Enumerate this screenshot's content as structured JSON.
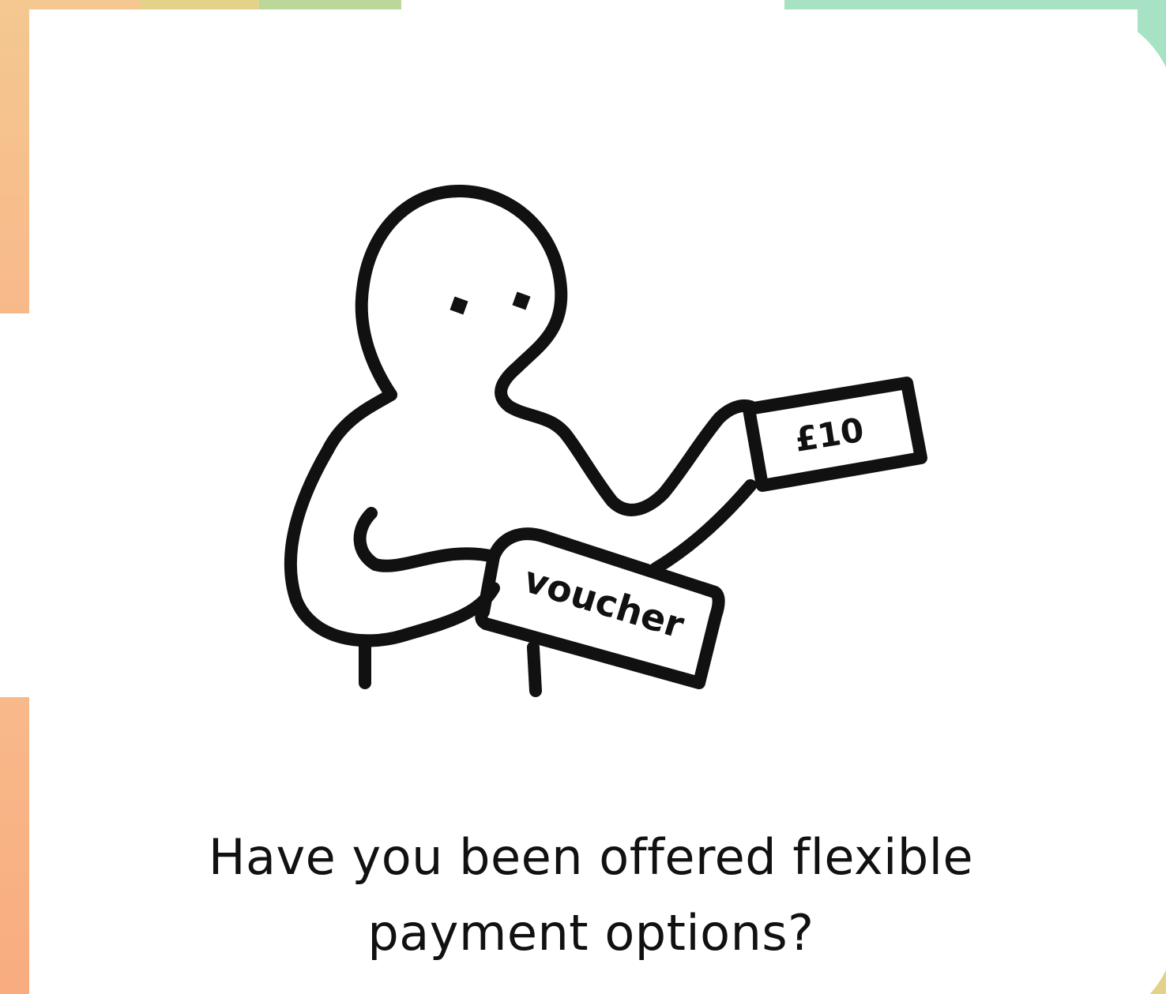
{
  "card": {
    "question": "Have you been offered flexible payment options?"
  },
  "illustration": {
    "icon": "person-holding-voucher-and-money-illustration",
    "voucher_label": "voucher",
    "money_label": "£10"
  },
  "colors": {
    "background": "#ffffff",
    "ink": "#111111",
    "band_orange": "#f8b98a",
    "band_peach": "#f4c890",
    "band_yellow": "#e4d28a",
    "band_green": "#bcd79a",
    "band_mint": "#a8e2c4"
  }
}
